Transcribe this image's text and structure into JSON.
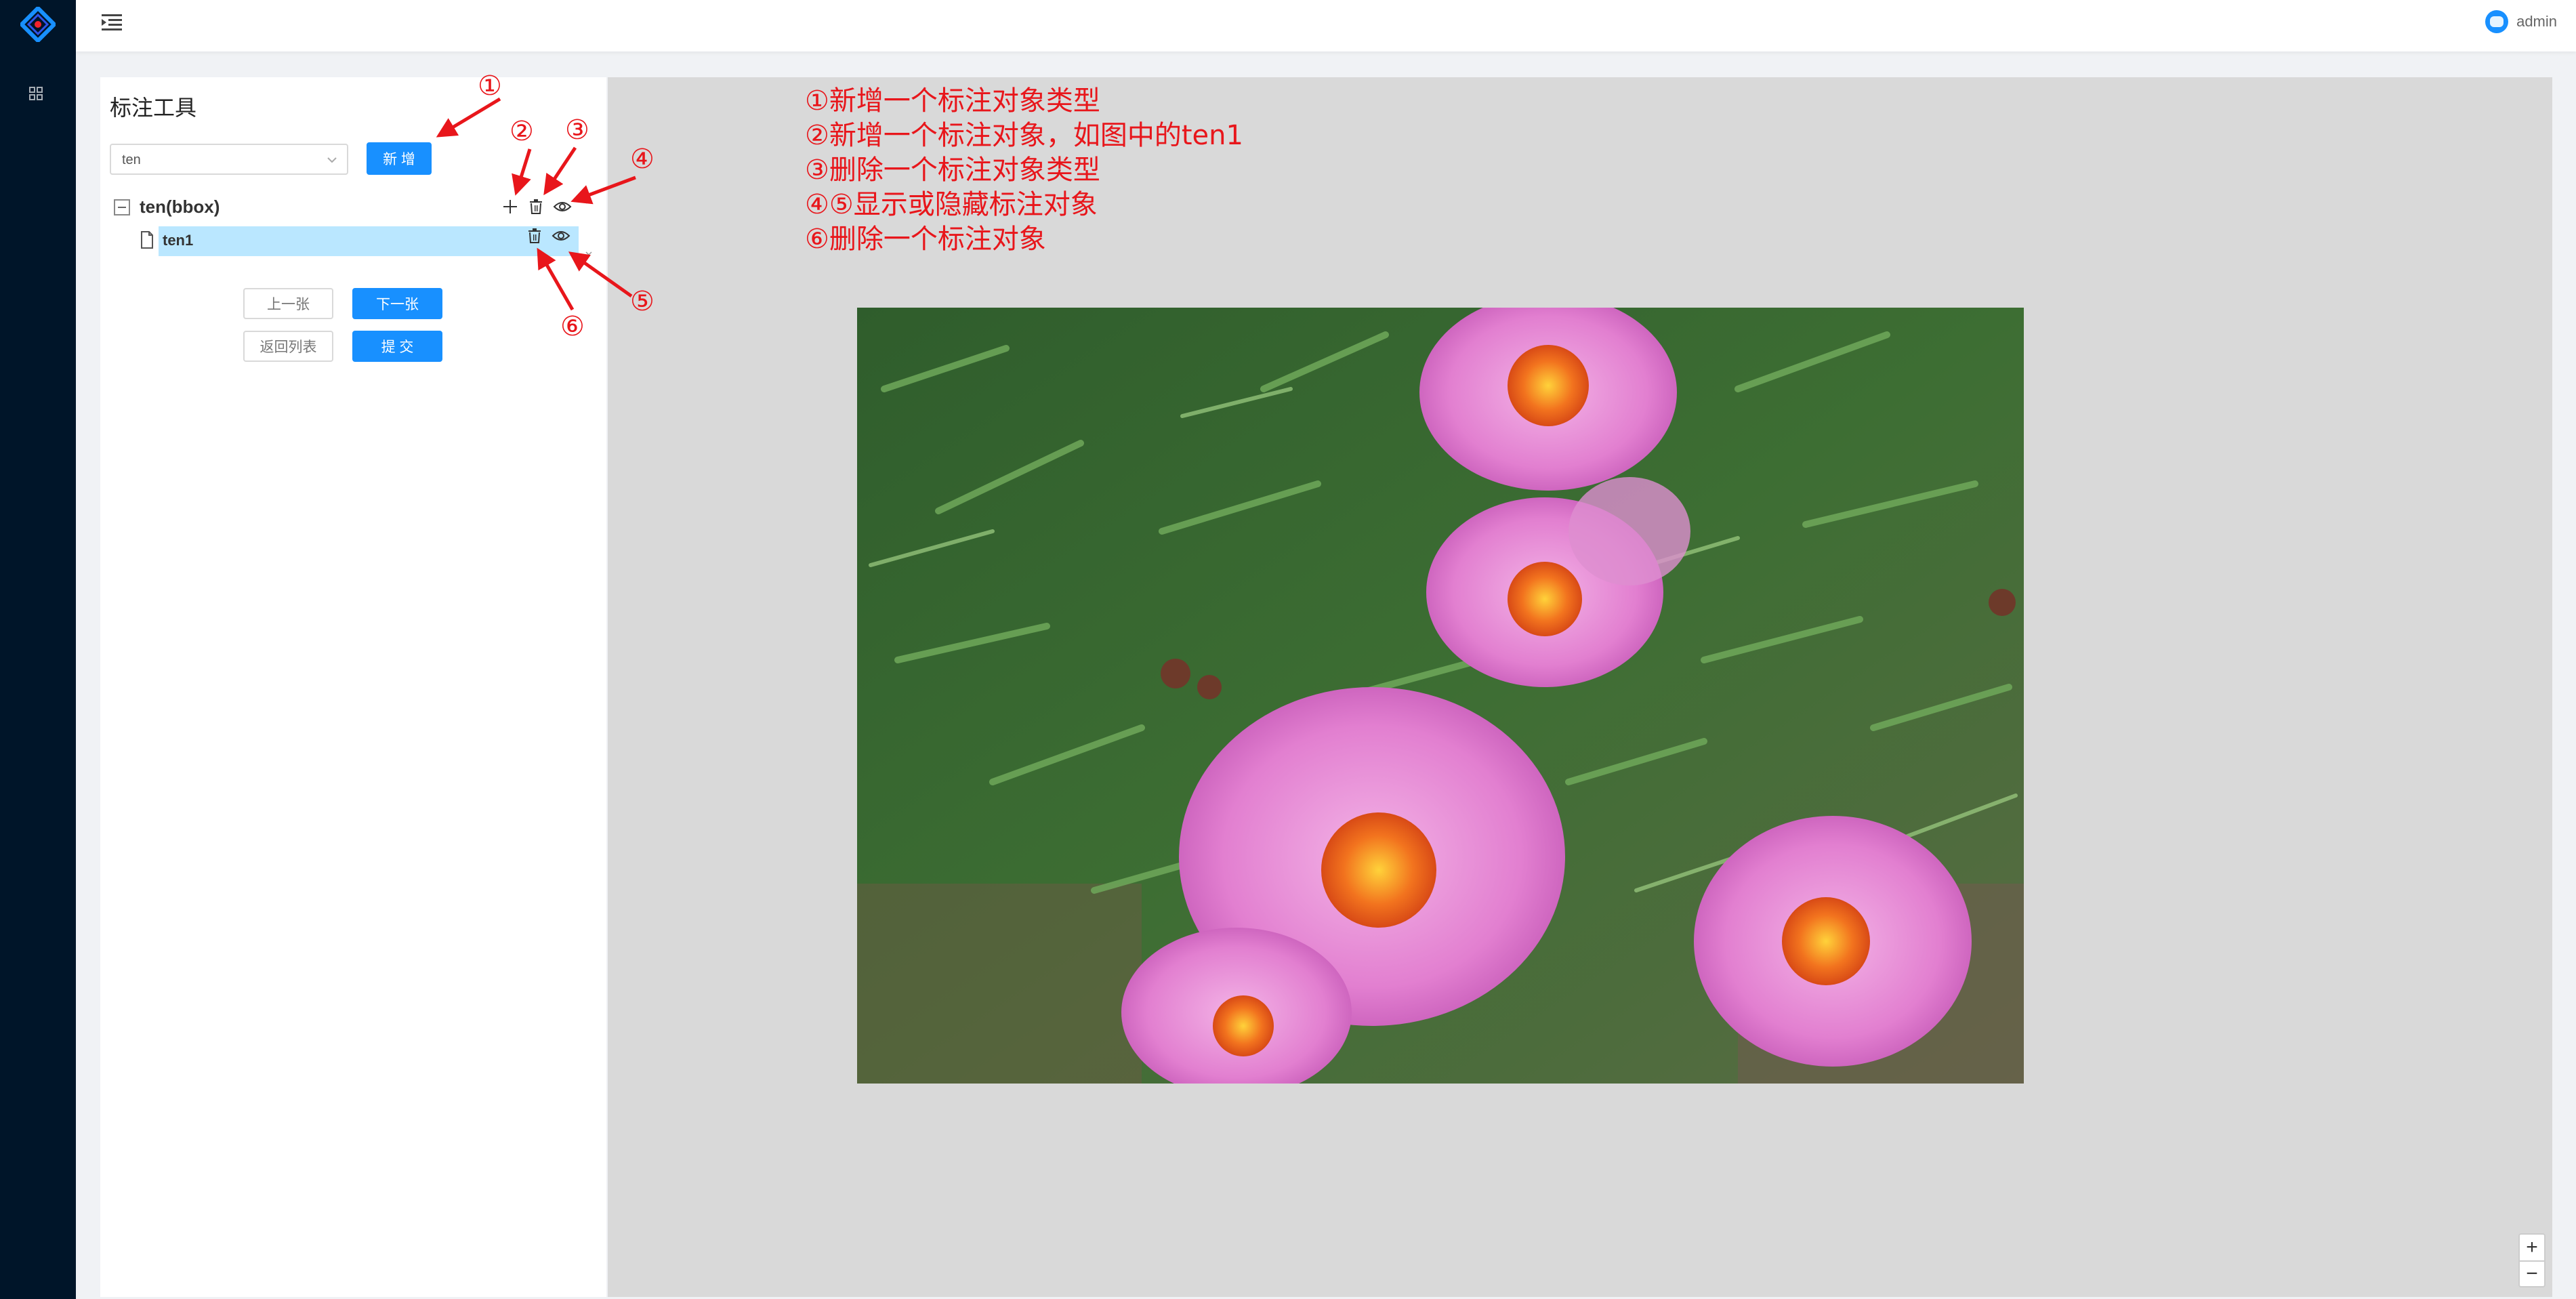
{
  "header": {
    "username": "admin"
  },
  "panel": {
    "title": "标注工具",
    "select_value": "ten",
    "add_button": "新 增",
    "tree": {
      "parent_label": "ten(bbox)",
      "child_label": "ten1"
    },
    "buttons": {
      "prev": "上一张",
      "next": "下一张",
      "back": "返回列表",
      "submit": "提 交"
    }
  },
  "annotations": {
    "lines": [
      "①新增一个标注对象类型",
      "②新增一个标注对象，如图中的ten1",
      "③删除一个标注对象类型",
      "④⑤显示或隐藏标注对象",
      "⑥删除一个标注对象"
    ],
    "markers": [
      "①",
      "②",
      "③",
      "④",
      "⑤",
      "⑥"
    ]
  },
  "zoom": {
    "in": "+",
    "out": "−"
  },
  "colors": {
    "sider": "#001529",
    "primary": "#1890ff",
    "annotation": "#e8161b",
    "selected_row": "#bae7ff"
  },
  "icons": [
    "app-logo-icon",
    "dashboard-icon",
    "menu-fold-icon",
    "plus-icon",
    "delete-icon",
    "eye-icon",
    "file-icon",
    "chevron-down-icon"
  ]
}
